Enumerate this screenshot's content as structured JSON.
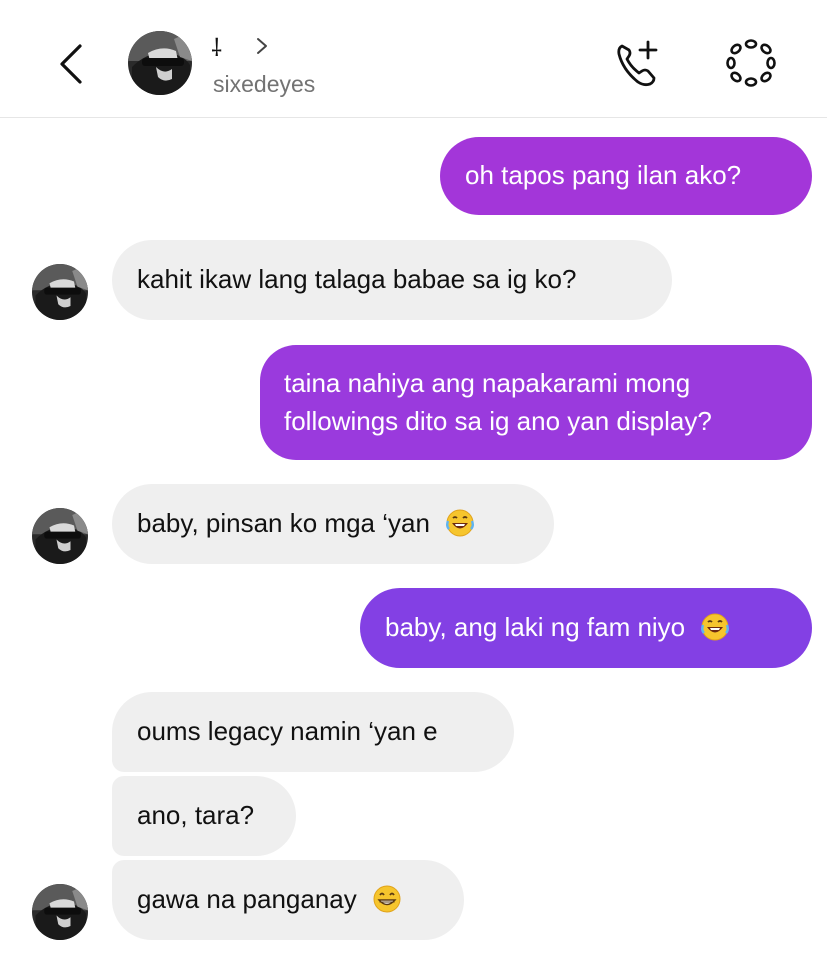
{
  "header": {
    "display_name": "⸸",
    "username": "sixedeyes",
    "back_icon": "chevron-left-icon",
    "call_icon": "phone-plus-icon",
    "effects_icon": "effects-icon"
  },
  "colors": {
    "outgoing_top": "#a336d9",
    "outgoing_mid": "#8f3ee0",
    "outgoing_bottom": "#7b3fe6",
    "incoming": "#efefef",
    "username": "#737373"
  },
  "messages": [
    {
      "side": "out",
      "text": "oh tapos pang ilan ako?"
    },
    {
      "side": "in",
      "text": "kahit ikaw lang talaga babae sa ig ko?"
    },
    {
      "side": "out",
      "line1": "taina nahiya ang napakarami mong",
      "line2": "followings dito sa ig ano yan display?"
    },
    {
      "side": "in",
      "text": "baby, pinsan ko mga ‘yan",
      "emoji": "rolling-on-floor-laughing"
    },
    {
      "side": "out",
      "text": "baby, ang laki ng fam niyo",
      "emoji": "rolling-on-floor-laughing"
    },
    {
      "side": "in",
      "text": "oums legacy namin ‘yan e"
    },
    {
      "side": "in",
      "text": "ano, tara?"
    },
    {
      "side": "in",
      "text": "gawa na panganay",
      "emoji": "grinning-face"
    }
  ]
}
